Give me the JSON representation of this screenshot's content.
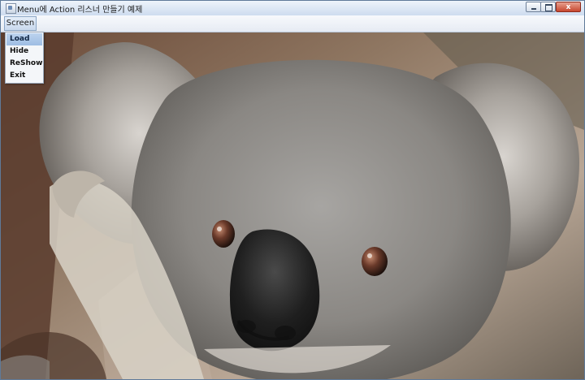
{
  "window": {
    "title": "Menu에 Action 리스너 만들기 예제",
    "controls": {
      "minimize_icon": "minimize-icon",
      "maximize_icon": "maximize-icon",
      "close_icon": "close-icon"
    }
  },
  "menubar": {
    "menus": [
      {
        "label": "Screen"
      }
    ]
  },
  "popup_menu": {
    "items": [
      {
        "label": "Load",
        "selected": true
      },
      {
        "label": "Hide",
        "selected": false
      },
      {
        "label": "ReShow",
        "selected": false
      },
      {
        "label": "Exit",
        "selected": false
      }
    ]
  },
  "content": {
    "image_subject": "koala"
  },
  "colors": {
    "menu_highlight": "#a9c6ea",
    "title_bar": "#dfe9f6",
    "close_button": "#c7472f"
  }
}
